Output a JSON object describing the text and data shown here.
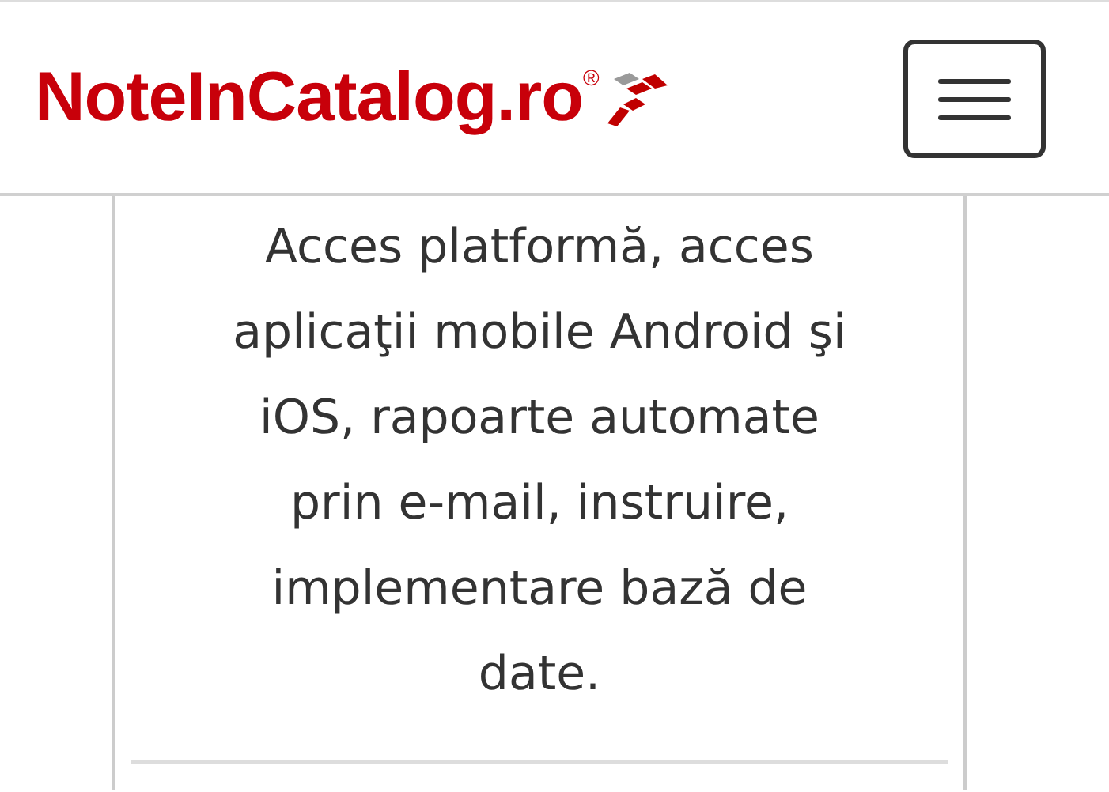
{
  "header": {
    "logo": "NoteInCatalog.ro$^{®}$"
  },
  "card": {
    "description": "Acces platformă, acces aplicaţii mobile Android şi iOS, rapoarte automate prin e-mail, instruire, implementare bază de date."
  }
}
